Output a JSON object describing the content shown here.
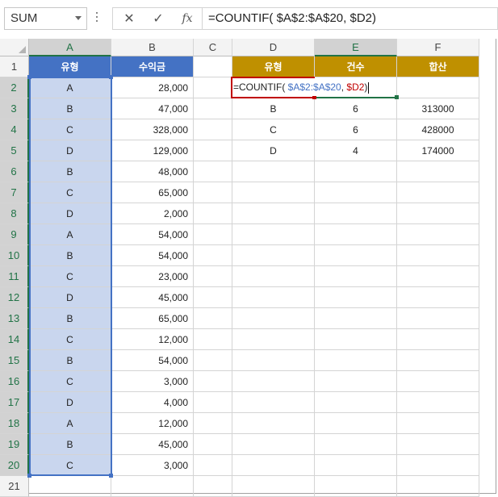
{
  "formula_bar": {
    "name_box": "SUM",
    "cancel_icon": "✕",
    "enter_icon": "✓",
    "fx_label": "fx",
    "formula": "=COUNTIF( $A$2:$A$20, $D2)"
  },
  "columns": [
    "A",
    "B",
    "C",
    "D",
    "E",
    "F"
  ],
  "rows": [
    "1",
    "2",
    "3",
    "4",
    "5",
    "6",
    "7",
    "8",
    "9",
    "10",
    "11",
    "12",
    "13",
    "14",
    "15",
    "16",
    "17",
    "18",
    "19",
    "20",
    "21"
  ],
  "table_left": {
    "header_type": "유형",
    "header_amount": "수익금",
    "rows": [
      {
        "type": "A",
        "amount": "28,000"
      },
      {
        "type": "B",
        "amount": "47,000"
      },
      {
        "type": "C",
        "amount": "328,000"
      },
      {
        "type": "D",
        "amount": "129,000"
      },
      {
        "type": "B",
        "amount": "48,000"
      },
      {
        "type": "C",
        "amount": "65,000"
      },
      {
        "type": "D",
        "amount": "2,000"
      },
      {
        "type": "A",
        "amount": "54,000"
      },
      {
        "type": "B",
        "amount": "54,000"
      },
      {
        "type": "C",
        "amount": "23,000"
      },
      {
        "type": "D",
        "amount": "45,000"
      },
      {
        "type": "B",
        "amount": "65,000"
      },
      {
        "type": "C",
        "amount": "12,000"
      },
      {
        "type": "B",
        "amount": "54,000"
      },
      {
        "type": "C",
        "amount": "3,000"
      },
      {
        "type": "D",
        "amount": "4,000"
      },
      {
        "type": "A",
        "amount": "12,000"
      },
      {
        "type": "B",
        "amount": "45,000"
      },
      {
        "type": "C",
        "amount": "3,000"
      }
    ]
  },
  "table_right": {
    "header_type": "유형",
    "header_count": "건수",
    "header_sum": "합산",
    "editing_formula": {
      "prefix": "=COUNTIF( ",
      "range": "$A$2:$A$20",
      "sep": ", ",
      "ref": "$D2",
      "suffix": ")"
    },
    "rows": [
      {
        "type": "B",
        "count": "6",
        "sum": "313000"
      },
      {
        "type": "C",
        "count": "6",
        "sum": "428000"
      },
      {
        "type": "D",
        "count": "4",
        "sum": "174000"
      }
    ]
  },
  "colors": {
    "header_blue": "#4472c4",
    "header_gold": "#bf9000",
    "selection_fill": "#c9d6ee",
    "ref_red": "#c00000",
    "active_green": "#217346"
  }
}
